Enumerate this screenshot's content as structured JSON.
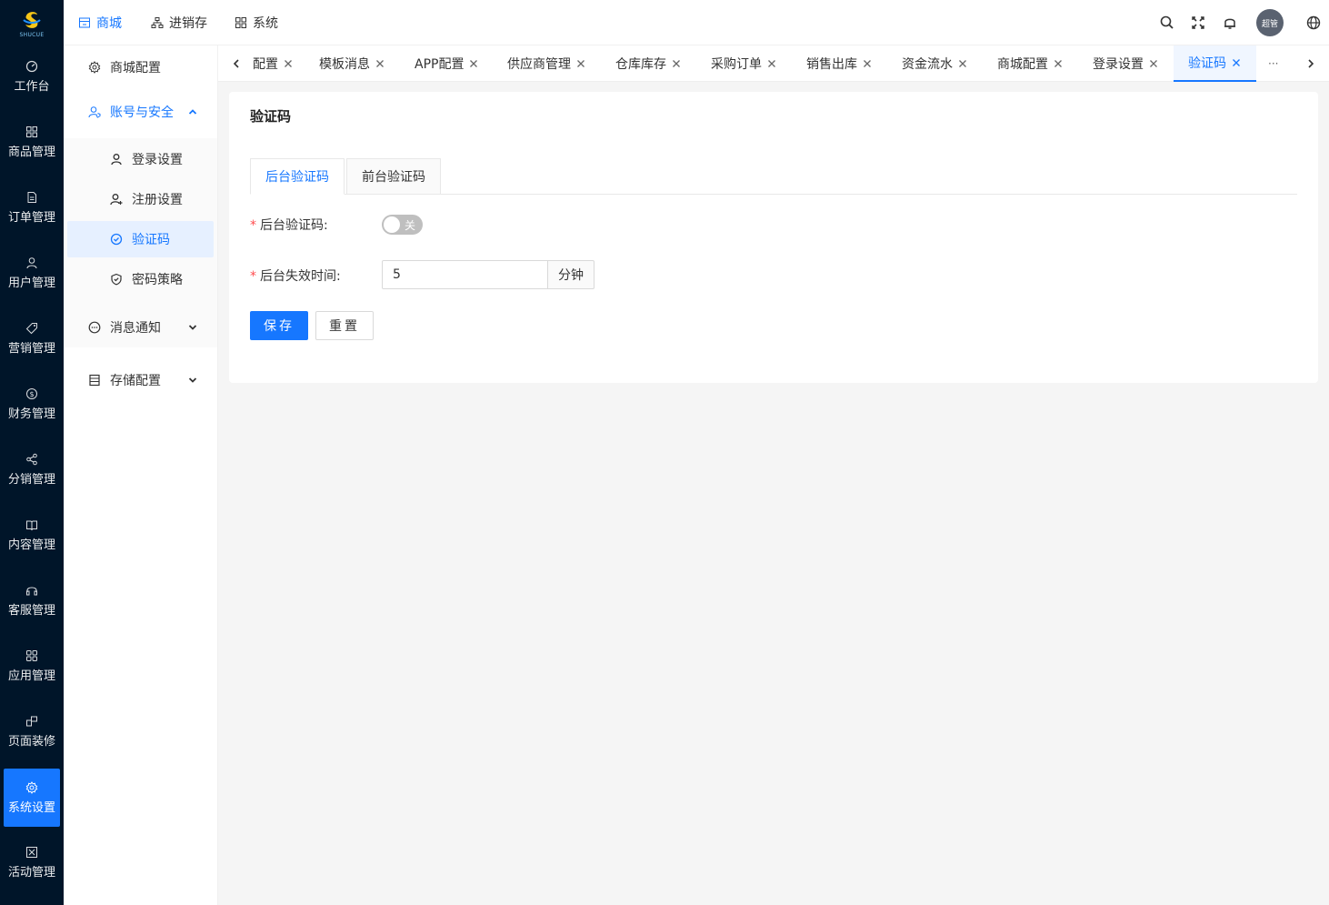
{
  "rail": {
    "brand": "SHUCUE",
    "items": [
      {
        "label": "工作台",
        "icon": "dashboard-icon"
      },
      {
        "label": "商品管理",
        "icon": "grid-icon"
      },
      {
        "label": "订单管理",
        "icon": "document-icon"
      },
      {
        "label": "用户管理",
        "icon": "user-icon"
      },
      {
        "label": "营销管理",
        "icon": "tag-icon"
      },
      {
        "label": "财务管理",
        "icon": "dollar-icon"
      },
      {
        "label": "分销管理",
        "icon": "share-icon"
      },
      {
        "label": "内容管理",
        "icon": "book-icon"
      },
      {
        "label": "客服管理",
        "icon": "headset-icon"
      },
      {
        "label": "应用管理",
        "icon": "apps-icon"
      },
      {
        "label": "页面装修",
        "icon": "layout-icon"
      },
      {
        "label": "系统设置",
        "icon": "gear-icon",
        "active": true
      },
      {
        "label": "活动管理",
        "icon": "activity-icon"
      }
    ]
  },
  "header": {
    "nav": [
      {
        "label": "商城",
        "icon": "shop-icon",
        "active": true
      },
      {
        "label": "进销存",
        "icon": "sitemap-icon"
      },
      {
        "label": "系统",
        "icon": "system-icon"
      }
    ],
    "avatar_text": "超管",
    "icons": [
      "search-icon",
      "fullscreen-icon",
      "bell-icon",
      "globe-icon"
    ]
  },
  "subnav": {
    "mall_config": "商城配置",
    "account_security": "账号与安全",
    "login_settings": "登录设置",
    "register_settings": "注册设置",
    "captcha": "验证码",
    "password_policy": "密码策略",
    "message_notice": "消息通知",
    "storage_config": "存储配置"
  },
  "tabs": {
    "items": [
      "配置",
      "模板消息",
      "APP配置",
      "供应商管理",
      "仓库库存",
      "采购订单",
      "销售出库",
      "资金流水",
      "商城配置",
      "登录设置"
    ],
    "active": "验证码",
    "more": "···"
  },
  "card": {
    "title": "验证码",
    "inner_tabs": [
      "后台验证码",
      "前台验证码"
    ],
    "field_captcha_label": "后台验证码:",
    "switch_text": "关",
    "field_expire_label": "后台失效时间:",
    "expire_value": "5",
    "expire_unit": "分钟",
    "save_label": "保存",
    "reset_label": "重置"
  },
  "colors": {
    "accent": "#1677ff",
    "rail_bg": "#001529",
    "required": "#ff4d4f"
  }
}
